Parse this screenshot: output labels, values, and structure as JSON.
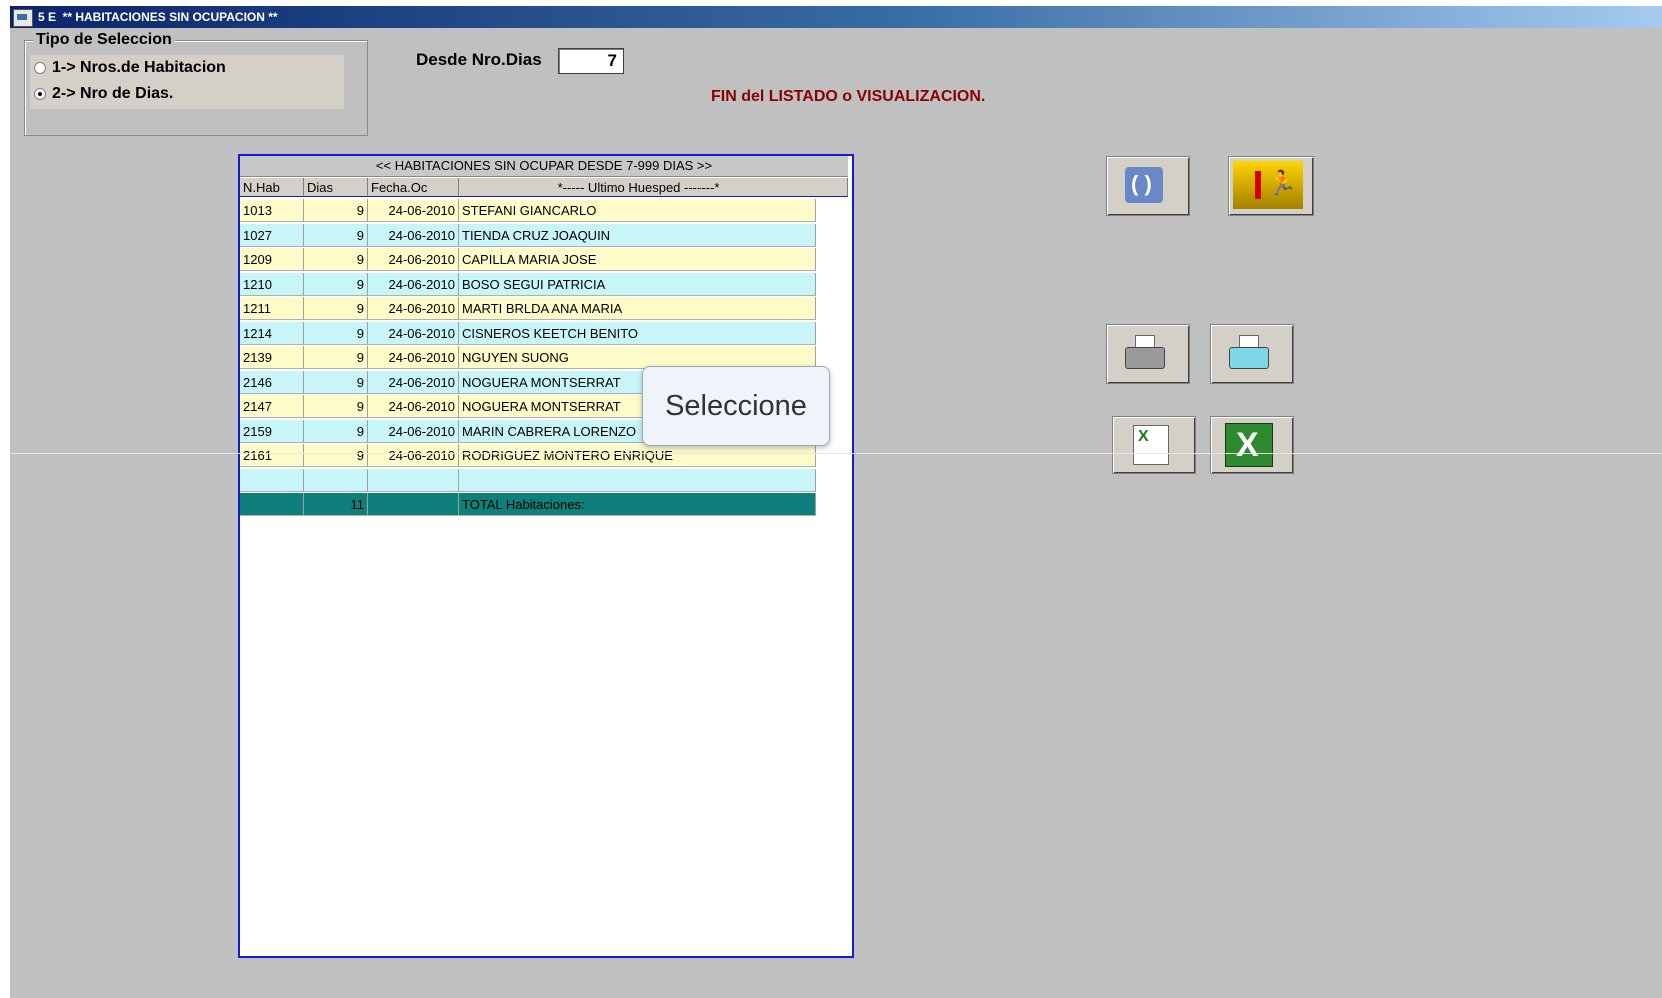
{
  "window": {
    "title": "5 E  ** HABITACIONES SIN OCUPACION **"
  },
  "selection_group": {
    "legend": "Tipo de Seleccion",
    "options": [
      {
        "label": "1-> Nros.de Habitacion",
        "checked": false
      },
      {
        "label": "2-> Nro de Dias.",
        "checked": true
      }
    ]
  },
  "days_filter": {
    "label": "Desde Nro.Dias",
    "value": "7"
  },
  "status_message": "FIN del LISTADO o VISUALIZACION.",
  "grid": {
    "title": "<<  HABITACIONES SIN OCUPAR DESDE   7-999 DIAS  >>",
    "columns": [
      "N.Hab",
      "Dias",
      "Fecha.Oc",
      "*----- Ultimo Huesped -------*"
    ],
    "rows": [
      {
        "hab": "1013",
        "dias": "9",
        "fecha": "24-06-2010",
        "huesped": "STEFANI GIANCARLO"
      },
      {
        "hab": "1027",
        "dias": "9",
        "fecha": "24-06-2010",
        "huesped": "TIENDA CRUZ JOAQUIN"
      },
      {
        "hab": "1209",
        "dias": "9",
        "fecha": "24-06-2010",
        "huesped": "CAPILLA MARIA JOSE"
      },
      {
        "hab": "1210",
        "dias": "9",
        "fecha": "24-06-2010",
        "huesped": "BOSO SEGUI PATRICIA"
      },
      {
        "hab": "1211",
        "dias": "9",
        "fecha": "24-06-2010",
        "huesped": "MARTI BRLDA ANA MARIA"
      },
      {
        "hab": "1214",
        "dias": "9",
        "fecha": "24-06-2010",
        "huesped": "CISNEROS KEETCH BENITO"
      },
      {
        "hab": "2139",
        "dias": "9",
        "fecha": "24-06-2010",
        "huesped": "NGUYEN SUONG"
      },
      {
        "hab": "2146",
        "dias": "9",
        "fecha": "24-06-2010",
        "huesped": "NOGUERA MONTSERRAT"
      },
      {
        "hab": "2147",
        "dias": "9",
        "fecha": "24-06-2010",
        "huesped": "NOGUERA MONTSERRAT"
      },
      {
        "hab": "2159",
        "dias": "9",
        "fecha": "24-06-2010",
        "huesped": "MARIN CABRERA LORENZO"
      },
      {
        "hab": "2161",
        "dias": "9",
        "fecha": "24-06-2010",
        "huesped": "RODRIGUEZ MONTERO ENRIQUE"
      }
    ],
    "total": {
      "count": "11",
      "label": "TOTAL Habitaciones:"
    }
  },
  "buttons": {
    "refresh": {
      "icon": "refresh-icon"
    },
    "exit": {
      "icon": "exit-door-icon"
    },
    "print_preview": {
      "icon": "printer-icon"
    },
    "print": {
      "icon": "printer-color-icon"
    },
    "export_excel_doc": {
      "icon": "excel-document-icon"
    },
    "open_excel": {
      "icon": "excel-icon"
    }
  },
  "tooltip": "Seleccione"
}
